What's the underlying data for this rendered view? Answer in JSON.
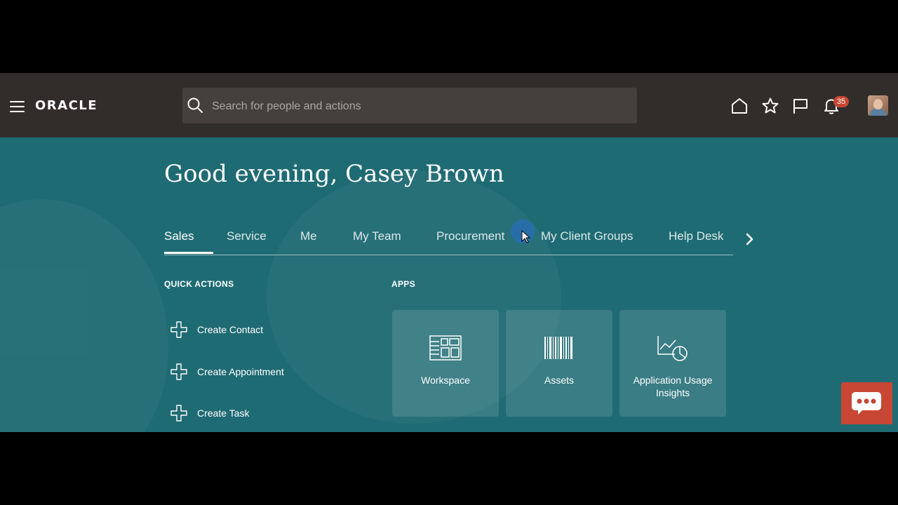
{
  "header": {
    "logo_text": "ORACLE",
    "search_placeholder": "Search for people and actions",
    "notification_count": "35",
    "icons": [
      "menu-icon",
      "home-icon",
      "favorites-icon",
      "watchlist-icon",
      "notifications-icon",
      "user-avatar"
    ]
  },
  "greeting": "Good evening, Casey Brown",
  "tabs": [
    {
      "label": "Sales",
      "active": true
    },
    {
      "label": "Service"
    },
    {
      "label": "Me"
    },
    {
      "label": "My Team"
    },
    {
      "label": "Procurement"
    },
    {
      "label": "My Client Groups"
    },
    {
      "label": "Help Desk"
    }
  ],
  "quick_actions": {
    "title": "QUICK ACTIONS",
    "items": [
      "Create Contact",
      "Create Appointment",
      "Create Task"
    ]
  },
  "apps": {
    "title": "APPS",
    "items": [
      {
        "label": "Workspace",
        "icon": "workspace-icon"
      },
      {
        "label": "Assets",
        "icon": "barcode-icon"
      },
      {
        "label": "Application Usage Insights",
        "icon": "chart-insights-icon"
      }
    ]
  },
  "colors": {
    "header_bg": "#312d2a",
    "page_bg": "#1f6b73",
    "badge": "#c74634",
    "chat_button": "#c74634"
  }
}
